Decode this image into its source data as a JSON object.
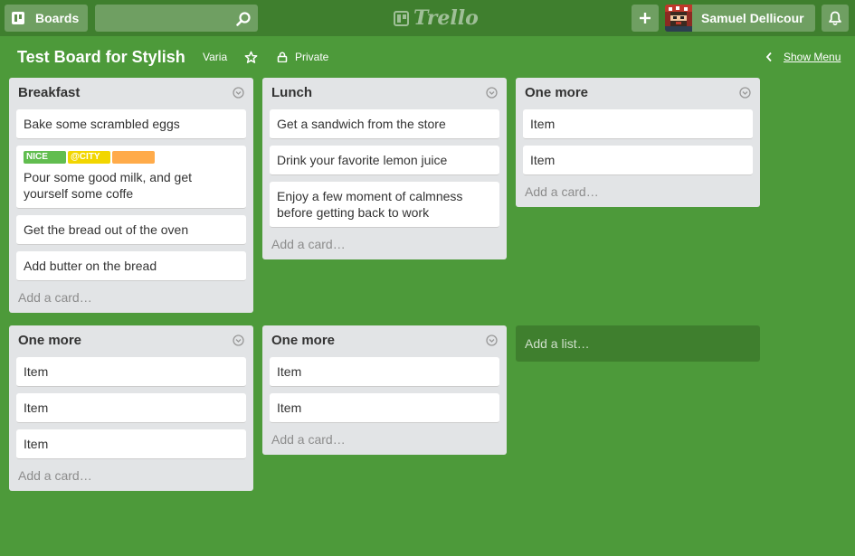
{
  "header": {
    "boards_label": "Boards",
    "search_value": "",
    "search_placeholder": "",
    "logo_text": "Trello",
    "user_name": "Samuel Dellicour"
  },
  "board": {
    "title": "Test Board for Stylish",
    "organization": "Varia",
    "visibility": "Private",
    "show_menu_label": "Show Menu"
  },
  "colors": {
    "background": "#4d9a3a",
    "header": "#3f7f2e",
    "label_green": "#61bd4f",
    "label_yellow": "#f2d600",
    "label_orange": "#ffab4a"
  },
  "lists": [
    {
      "title": "Breakfast",
      "cards": [
        {
          "text": "Bake some scrambled eggs"
        },
        {
          "text": "Pour some good milk, and get yourself some coffe",
          "labels": [
            {
              "text": "NICE",
              "color": "#61bd4f"
            },
            {
              "text": "@CITY",
              "color": "#f2d600"
            },
            {
              "text": "",
              "color": "#ffab4a"
            }
          ]
        },
        {
          "text": "Get the bread out of the oven"
        },
        {
          "text": "Add butter on the bread"
        }
      ],
      "add_card": "Add a card…"
    },
    {
      "title": "Lunch",
      "cards": [
        {
          "text": "Get a sandwich from the store"
        },
        {
          "text": "Drink your favorite lemon juice"
        },
        {
          "text": "Enjoy a few moment of calmness before getting back to work"
        }
      ],
      "add_card": "Add a card…"
    },
    {
      "title": "One more",
      "cards": [
        {
          "text": "Item"
        },
        {
          "text": "Item"
        }
      ],
      "add_card": "Add a card…"
    },
    {
      "title": "One more",
      "cards": [
        {
          "text": "Item"
        },
        {
          "text": "Item"
        },
        {
          "text": "Item"
        }
      ],
      "add_card": "Add a card…"
    },
    {
      "title": "One more",
      "cards": [
        {
          "text": "Item"
        },
        {
          "text": "Item"
        }
      ],
      "add_card": "Add a card…"
    }
  ],
  "add_list_label": "Add a list…"
}
